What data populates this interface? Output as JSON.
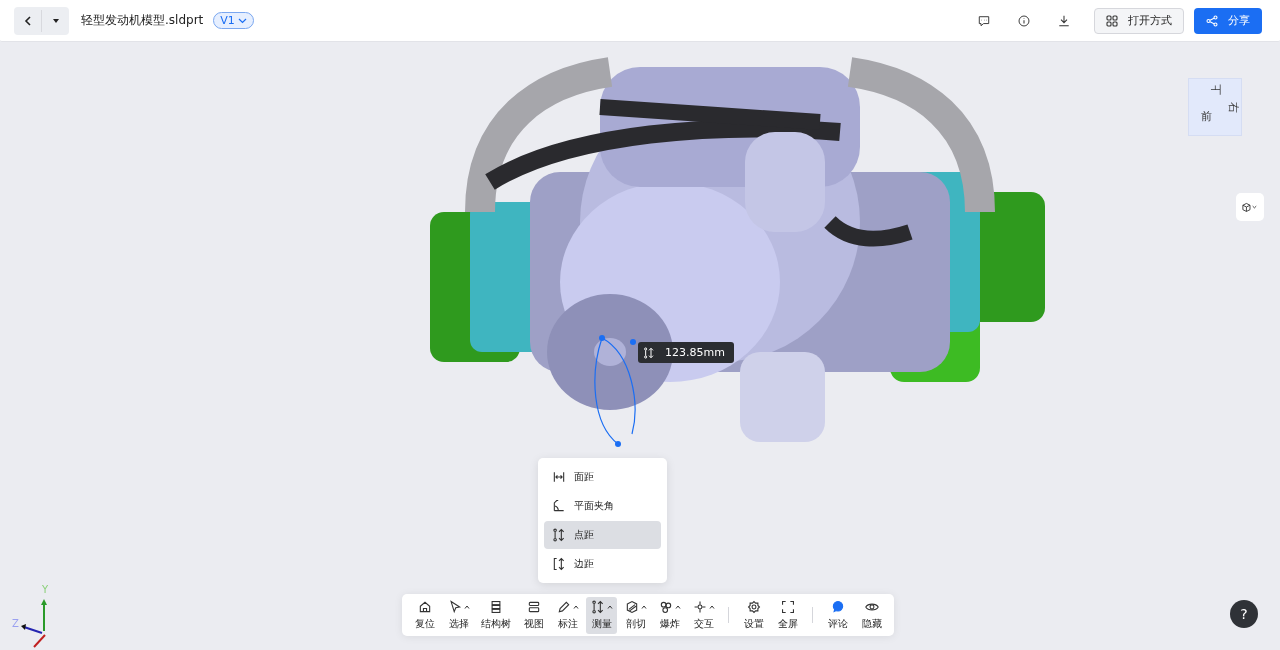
{
  "header": {
    "file_name": "轻型发动机模型.sldprt",
    "version": "V1",
    "open_with": "打开方式",
    "share": "分享"
  },
  "view_cube": {
    "faces": [
      "上",
      "前",
      "右"
    ]
  },
  "measurement": {
    "reading": "123.85mm"
  },
  "measure_menu": {
    "items": [
      {
        "label": "面距",
        "selected": false
      },
      {
        "label": "平面夹角",
        "selected": false
      },
      {
        "label": "点距",
        "selected": true
      },
      {
        "label": "边距",
        "selected": false
      }
    ]
  },
  "toolbar": {
    "groups": [
      [
        {
          "label": "复位",
          "dropdown": false,
          "selected": false
        },
        {
          "label": "选择",
          "dropdown": true,
          "selected": false
        },
        {
          "label": "结构树",
          "dropdown": false,
          "selected": false
        },
        {
          "label": "视图",
          "dropdown": false,
          "selected": false
        },
        {
          "label": "标注",
          "dropdown": true,
          "selected": false
        },
        {
          "label": "测量",
          "dropdown": true,
          "selected": true
        },
        {
          "label": "剖切",
          "dropdown": true,
          "selected": false
        },
        {
          "label": "爆炸",
          "dropdown": true,
          "selected": false
        },
        {
          "label": "交互",
          "dropdown": true,
          "selected": false
        }
      ],
      [
        {
          "label": "设置",
          "dropdown": false,
          "selected": false
        },
        {
          "label": "全屏",
          "dropdown": false,
          "selected": false
        }
      ],
      [
        {
          "label": "评论",
          "dropdown": false,
          "selected": false
        },
        {
          "label": "隐藏",
          "dropdown": false,
          "selected": false
        }
      ]
    ]
  },
  "axes": {
    "y": "Y",
    "z": "Z"
  },
  "help": "?"
}
